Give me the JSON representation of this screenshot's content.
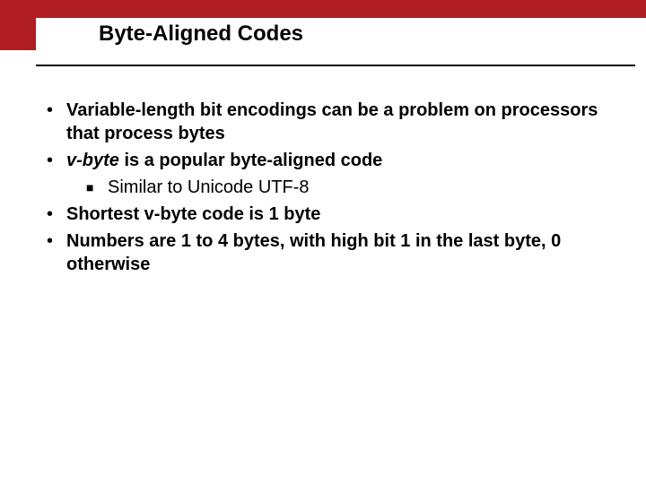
{
  "title": "Byte-Aligned Codes",
  "bullets": {
    "b1": "Variable-length bit encodings can be a problem on processors that process bytes",
    "b2_prefix": "v-byte",
    "b2_rest": " is a popular byte-aligned code",
    "b2_sub": "Similar to Unicode UTF-8",
    "b3": "Shortest v-byte code is 1 byte",
    "b4": "Numbers are 1 to 4 bytes, with high bit 1 in the last byte, 0 otherwise"
  }
}
